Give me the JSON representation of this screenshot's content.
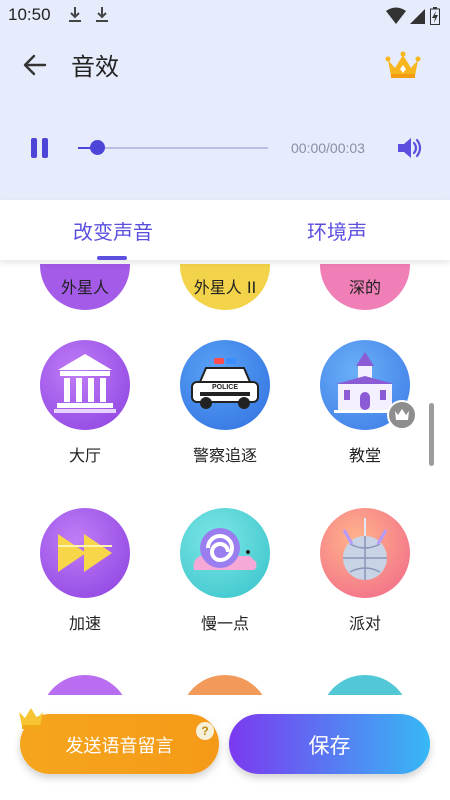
{
  "status_bar": {
    "time": "10:50",
    "icons": [
      "download-icon",
      "download-icon",
      "wifi-icon",
      "signal-icon",
      "battery-icon"
    ]
  },
  "app_bar": {
    "title": "音效",
    "back_icon": "arrow-left-icon",
    "premium_icon": "crown-icon"
  },
  "player": {
    "state_icon": "pause-icon",
    "progress": 0.1,
    "time_text": "00:00/00:03",
    "volume_icon": "speaker-icon"
  },
  "tabs": [
    {
      "label": "改变声音",
      "selected": true
    },
    {
      "label": "环境声",
      "selected": false
    }
  ],
  "effects": {
    "row_partial_top": [
      "外星人",
      "外星人 II",
      "深的"
    ],
    "row1": [
      {
        "label": "大厅",
        "icon": "hall-icon",
        "locked": false
      },
      {
        "label": "警察追逐",
        "icon": "police-car-icon",
        "car_text": "POLICE",
        "locked": false
      },
      {
        "label": "教堂",
        "icon": "church-icon",
        "locked": true
      }
    ],
    "row2": [
      {
        "label": "加速",
        "icon": "fast-forward-icon",
        "locked": false
      },
      {
        "label": "慢一点",
        "icon": "snail-icon",
        "locked": false
      },
      {
        "label": "派对",
        "icon": "disco-ball-icon",
        "locked": false
      }
    ]
  },
  "buttons": {
    "voice_message": "发送语音留言",
    "help_mark": "?",
    "save": "保存"
  },
  "colors": {
    "accent": "#5b4fe0",
    "header_bg": "#e6ecfb",
    "orange_button": "#f5a51d",
    "save_gradient_start": "#7b39f0",
    "save_gradient_end": "#37b8f5"
  }
}
